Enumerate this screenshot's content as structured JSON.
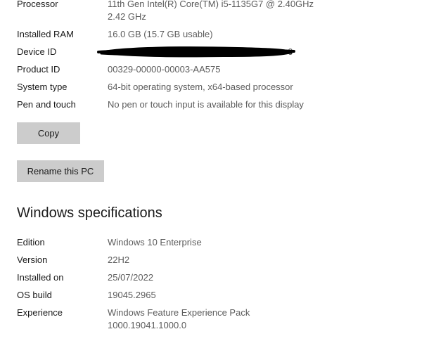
{
  "device_specs": {
    "processor": {
      "label": "Processor",
      "value_line1": "11th Gen Intel(R) Core(TM) i5-1135G7 @ 2.40GHz",
      "value_line2": "2.42 GHz"
    },
    "ram": {
      "label": "Installed RAM",
      "value": "16.0 GB (15.7 GB usable)"
    },
    "device_id": {
      "label": "Device ID",
      "value_visible_tail": "6"
    },
    "product_id": {
      "label": "Product ID",
      "value": "00329-00000-00003-AA575"
    },
    "system_type": {
      "label": "System type",
      "value": "64-bit operating system, x64-based processor"
    },
    "pen_touch": {
      "label": "Pen and touch",
      "value": "No pen or touch input is available for this display"
    }
  },
  "buttons": {
    "copy": "Copy",
    "rename": "Rename this PC"
  },
  "windows_specs": {
    "heading": "Windows specifications",
    "edition": {
      "label": "Edition",
      "value": "Windows 10 Enterprise"
    },
    "version": {
      "label": "Version",
      "value": "22H2"
    },
    "installed_on": {
      "label": "Installed on",
      "value": "25/07/2022"
    },
    "os_build": {
      "label": "OS build",
      "value": "19045.2965"
    },
    "experience": {
      "label": "Experience",
      "value_line1": "Windows Feature Experience Pack",
      "value_line2": "1000.19041.1000.0"
    }
  },
  "colors": {
    "text": "#1a1a1a",
    "value_text": "#5c5c5c",
    "button_bg": "#cccccc",
    "redaction": "#000000"
  }
}
